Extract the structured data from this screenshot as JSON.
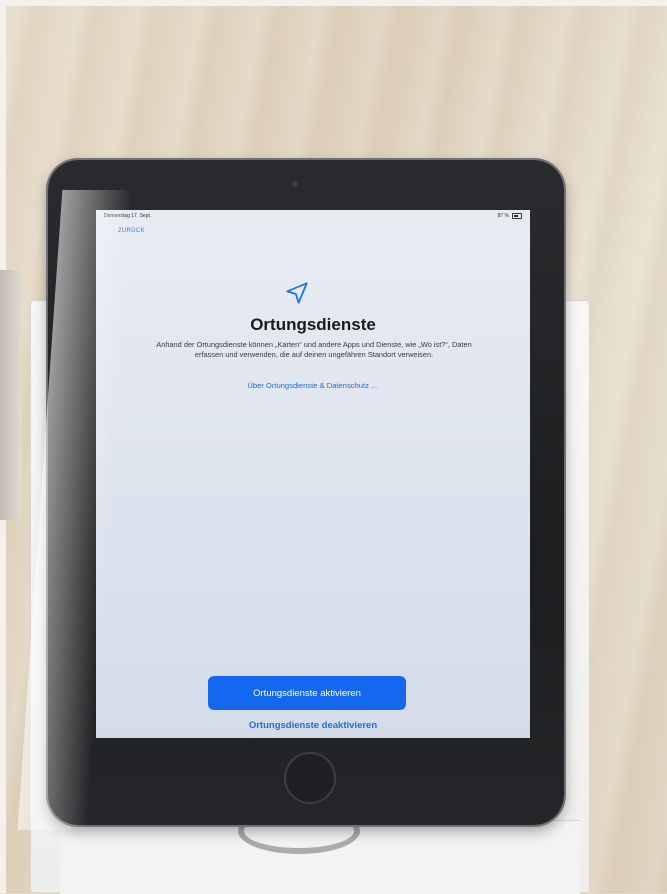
{
  "status_bar": {
    "date": "Donnerstag 17. Sept.",
    "battery": "87 %"
  },
  "nav": {
    "back_label": "ZURÜCK"
  },
  "icons": {
    "location": "location-arrow-icon"
  },
  "main": {
    "title": "Ortungsdienste",
    "description": "Anhand der Ortungsdienste können „Karten“ und andere Apps und Dienste, wie „Wo ist?“, Daten erfassen und verwenden, die auf deinen ungefähren Standort verweisen.",
    "privacy_link": "Über Ortungsdienste & Datenschutz …"
  },
  "actions": {
    "enable_label": "Ortungsdienste aktivieren",
    "disable_label": "Ortungsdienste deaktivieren"
  },
  "colors": {
    "accent": "#1468f0",
    "link": "#1f6fe0",
    "screen_background": "#e2e7f0"
  }
}
